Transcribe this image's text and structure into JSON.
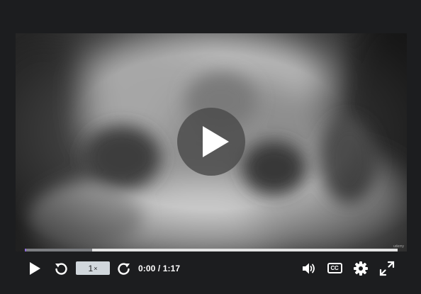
{
  "player": {
    "watermark": "udemy",
    "progress": {
      "played_fraction": 0.0,
      "buffered_fraction": 0.18
    }
  },
  "controls": {
    "speed_label": "1",
    "speed_suffix": "×",
    "current_time": "0:00",
    "time_separator": " / ",
    "duration": "1:17"
  },
  "icons": {
    "big_play": "play-icon",
    "play": "play-icon",
    "rewind": "rewind-icon",
    "forward": "forward-icon",
    "volume": "volume-icon",
    "captions": "captions-icon",
    "settings": "gear-icon",
    "fullscreen": "expand-icon"
  },
  "colors": {
    "background": "#1c1d1f",
    "accent": "#8f6ad9",
    "speed_button": "#d1d7dc"
  }
}
